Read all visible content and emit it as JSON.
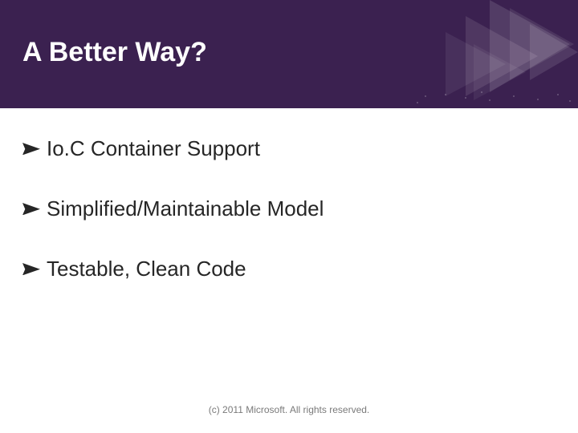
{
  "slide": {
    "title": "A Better Way?",
    "bullets": [
      "Io.C Container  Support",
      "Simplified/Maintainable Model",
      "Testable, Clean Code"
    ],
    "footer": "(c) 2011 Microsoft. All rights reserved."
  },
  "colors": {
    "header_bg": "#3b2150",
    "title_text": "#ffffff",
    "bullet_arrow": "#262626",
    "body_text": "#262626",
    "footer_text": "#7a7a7a"
  }
}
